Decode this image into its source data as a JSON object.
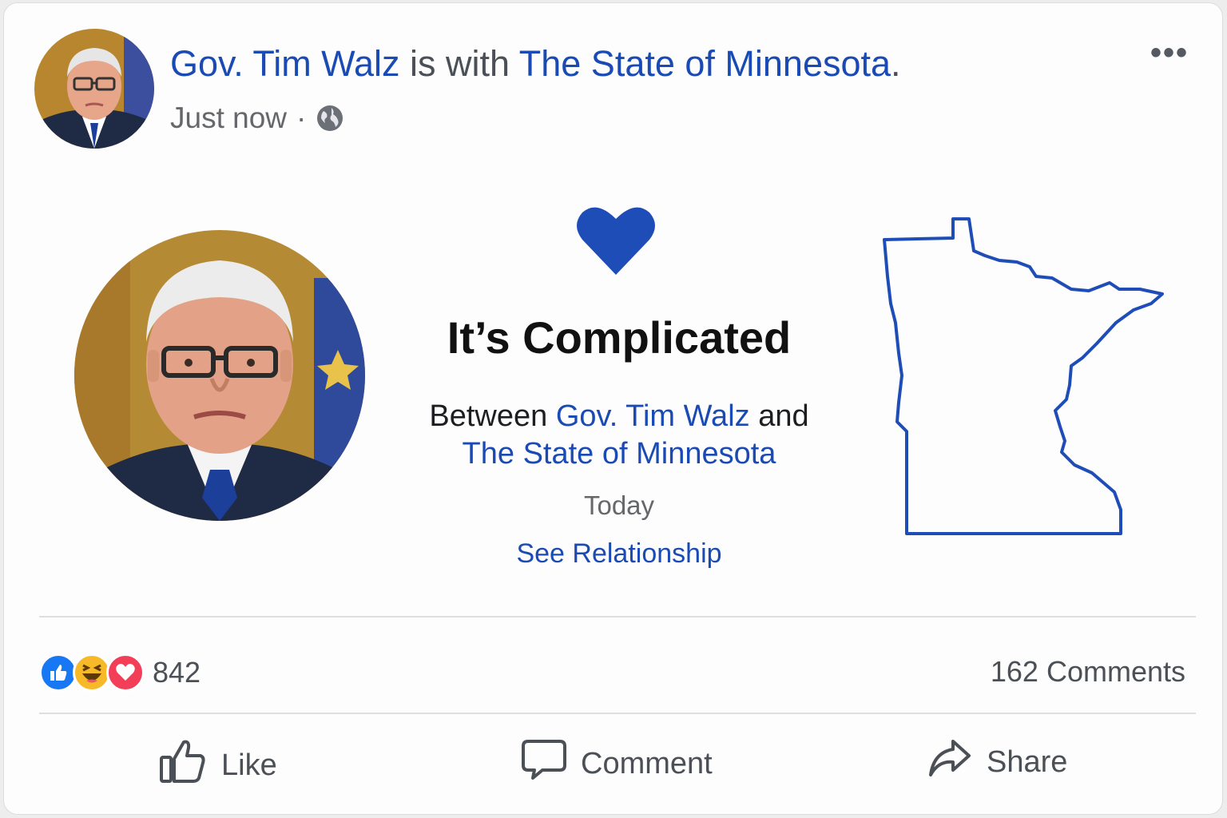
{
  "post": {
    "author": "Gov. Tim Walz",
    "with_text": "is with",
    "tagged": "The State of Minnesota",
    "period": ".",
    "time": "Just now",
    "separator": "·",
    "privacy_icon": "globe-icon",
    "more_label": "•••"
  },
  "relationship": {
    "icon": "heart-icon",
    "status": "It’s Complicated",
    "between_prefix": "Between",
    "person": "Gov. Tim Walz",
    "conjunction": "and",
    "other": "The State of Minnesota",
    "date": "Today",
    "link": "See Relationship"
  },
  "stats": {
    "reactions": [
      "like",
      "haha",
      "love"
    ],
    "reaction_count": "842",
    "comments": "162 Comments"
  },
  "actions": [
    {
      "label": "Like",
      "icon": "thumbs-up-icon"
    },
    {
      "label": "Comment",
      "icon": "comment-bubble-icon"
    },
    {
      "label": "Share",
      "icon": "share-arrow-icon"
    }
  ],
  "colors": {
    "link": "#1a4bb5",
    "like": "#1877f2",
    "love": "#f33e58",
    "haha": "#f7b928"
  }
}
